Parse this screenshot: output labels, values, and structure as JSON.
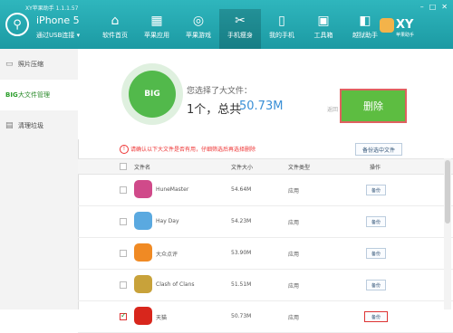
{
  "window": {
    "title": "XY苹果助手 1.1.1.57",
    "controls": [
      "–",
      "□",
      "✕"
    ]
  },
  "device": {
    "name": "iPhone 5",
    "status": "通过USB连接",
    "status_caret": "▾"
  },
  "nav": [
    {
      "label": "软件首页",
      "icon": "home-icon",
      "glyph": "⌂",
      "active": false
    },
    {
      "label": "苹果应用",
      "icon": "apps-icon",
      "glyph": "▦",
      "active": false
    },
    {
      "label": "苹果游戏",
      "icon": "gamepad-icon",
      "glyph": "◎",
      "active": false
    },
    {
      "label": "手机瘦身",
      "icon": "broom-icon",
      "glyph": "✂",
      "active": true
    },
    {
      "label": "我的手机",
      "icon": "phone-icon",
      "glyph": "▯",
      "active": false
    },
    {
      "label": "工具箱",
      "icon": "toolbox-icon",
      "glyph": "▣",
      "active": false
    },
    {
      "label": "越狱助手",
      "icon": "jailbreak-icon",
      "glyph": "◧",
      "active": false
    }
  ],
  "brand": {
    "name": "XY",
    "sub": "苹果助手"
  },
  "sidebar": [
    {
      "label": "照片压缩",
      "glyph": "▭",
      "icon": "photo-icon",
      "active": false
    },
    {
      "label": "大文件管理",
      "glyph": "BIG",
      "icon": "big-icon",
      "active": true
    },
    {
      "label": "清理垃圾",
      "glyph": "▤",
      "icon": "clean-icon",
      "active": false
    }
  ],
  "summary": {
    "badge": "BIG",
    "selected_label": "您选择了大文件：",
    "count": "1个，总共",
    "size": "50.73M",
    "note": "返回",
    "delete_label": "删除"
  },
  "warning": {
    "icon": "!",
    "text": "请确认以下大文件是否有用，仔细筛选后再选择删除",
    "backup_selected": "备份选中文件"
  },
  "table": {
    "headers": {
      "name": "文件名",
      "size": "文件大小",
      "type": "文件类型",
      "op": "操作"
    },
    "rows": [
      {
        "name": "HuneMaster",
        "size": "54.64M",
        "type": "应用",
        "op": "备份",
        "checked": false,
        "color": "#d04a8a"
      },
      {
        "name": "Hay Day",
        "size": "54.23M",
        "type": "应用",
        "op": "备份",
        "checked": false,
        "color": "#5aa9e0"
      },
      {
        "name": "大众点评",
        "size": "53.90M",
        "type": "应用",
        "op": "备份",
        "checked": false,
        "color": "#f08a24"
      },
      {
        "name": "Clash of Clans",
        "size": "51.51M",
        "type": "应用",
        "op": "备份",
        "checked": false,
        "color": "#c8a23a"
      },
      {
        "name": "天猫",
        "size": "50.73M",
        "type": "应用",
        "op": "备份",
        "checked": true,
        "color": "#d8261c"
      }
    ]
  }
}
